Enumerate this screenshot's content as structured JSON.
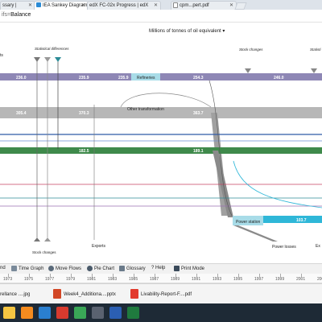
{
  "browser": {
    "tabs": [
      {
        "label": "ssary |",
        "active": false
      },
      {
        "label": "IEA Sankey Diagram",
        "active": true
      },
      {
        "label": "edX FC-02x Progress | edX",
        "active": false
      },
      {
        "label": "cpm...pert.pdf",
        "active": false
      }
    ],
    "url_prefix": "ifs=",
    "url_value": "Balance"
  },
  "diagram": {
    "units_selector": "Millions of tonnes of oil equivalent ▾",
    "left_label": "ts",
    "labels": {
      "statistical_differences_left": "Statistical differences",
      "stock_changes_top": "Stock changes",
      "statistical_differences_right": "Statisti",
      "refineries": "Refineries",
      "other_transformation": "Other transformation",
      "power_station": "Power station",
      "power_losses": "Power losses",
      "stock_changes_bottom": "Stock changes",
      "exports": "Exports",
      "right_cut": "Ex"
    },
    "values": {
      "oil_1": "236.0",
      "oil_2": "235.9",
      "oil_3": "235.9",
      "oil_4": "254.3",
      "oil_5": "246.0",
      "gas_1": "305.4",
      "gas_2": "370.3",
      "gas_3": "363.7",
      "coal_1": "182.5",
      "coal_2": "189.1",
      "power_out": "103.7"
    },
    "colors": {
      "oil": "#8e87b5",
      "gas": "#b7b7b7",
      "coal": "#3f8a4b",
      "electricity": "#2fb7d8",
      "blue_thin": "#2f5aa8",
      "red_thin": "#c94060",
      "teal": "#2b8b96",
      "node": "#a8dce8"
    }
  },
  "toolbar": [
    {
      "label": "nd",
      "icon": "legend-icon"
    },
    {
      "label": "Time Graph",
      "icon": "time-graph-icon"
    },
    {
      "label": "Move Flows",
      "icon": "move-flows-icon"
    },
    {
      "label": "Pie Chart",
      "icon": "pie-chart-icon"
    },
    {
      "label": "Glossary",
      "icon": "glossary-icon"
    },
    {
      "label": "Help",
      "icon": "help-icon"
    },
    {
      "label": "Print Mode",
      "icon": "print-icon"
    }
  ],
  "timeline_years": [
    "1973",
    "1975",
    "1977",
    "1979",
    "1981",
    "1983",
    "1985",
    "1987",
    "1989",
    "1991",
    "1993",
    "1995",
    "1997",
    "1999",
    "2001",
    "2003"
  ],
  "downloads": [
    {
      "label": "rellance ....jpg",
      "icon": "image-file-icon"
    },
    {
      "label": "Week4_Additiona....pptx",
      "icon": "pptx-file-icon"
    },
    {
      "label": "Livability-Report-F....pdf",
      "icon": "pdf-file-icon"
    }
  ],
  "taskbar": [
    {
      "icon": "file-explorer-icon",
      "color": "#f4c542"
    },
    {
      "icon": "illustrator-icon",
      "color": "#f48b1f"
    },
    {
      "icon": "photoshop-icon",
      "color": "#2a7fd0"
    },
    {
      "icon": "acrobat-icon",
      "color": "#d83a2e"
    },
    {
      "icon": "chrome-icon",
      "color": "#3aa757"
    },
    {
      "icon": "settings-icon",
      "color": "#5a6270"
    },
    {
      "icon": "word-icon",
      "color": "#2b5fb3"
    },
    {
      "icon": "excel-icon",
      "color": "#1f7a3e"
    }
  ]
}
